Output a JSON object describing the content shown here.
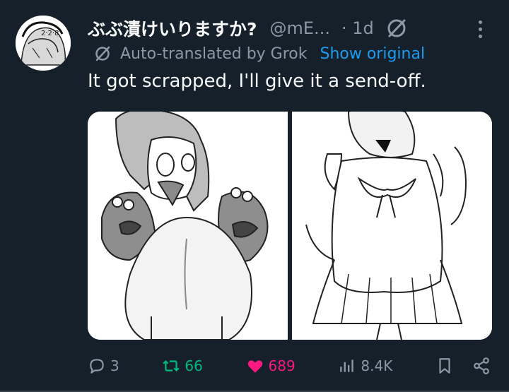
{
  "tweet": {
    "display_name": "ぶぶ漬けいりますか?",
    "handle": "@mE...",
    "time": "· 1d",
    "translation_note": "Auto-translated by Grok",
    "show_original": "Show original",
    "text": "It got scrapped, I'll give it a send-off.",
    "avatar_text": "2·2·8"
  },
  "actions": {
    "replies": "3",
    "retweets": "66",
    "likes": "689",
    "views": "8.4K"
  },
  "colors": {
    "background": "#15202b",
    "secondary_text": "#8b98a5",
    "link": "#1d9bf0",
    "retweet": "#00ba7c",
    "like": "#f91880"
  },
  "icons": [
    "grok-icon",
    "more-icon",
    "reply-icon",
    "retweet-icon",
    "like-icon",
    "views-icon",
    "bookmark-icon",
    "share-icon"
  ]
}
